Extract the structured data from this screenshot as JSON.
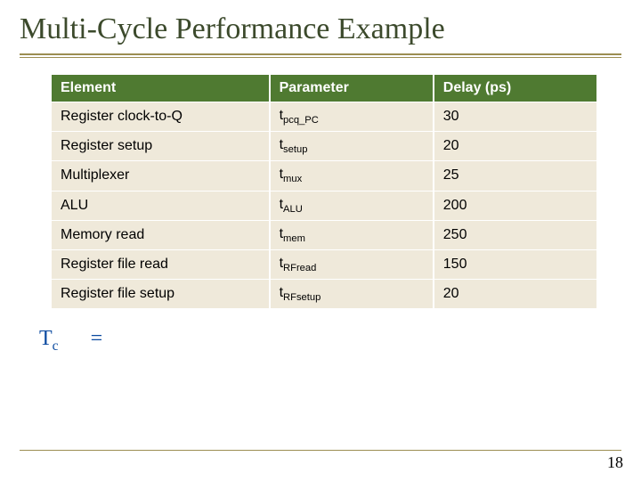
{
  "title": "Multi-Cycle Performance Example",
  "headers": {
    "element": "Element",
    "parameter": "Parameter",
    "delay": "Delay (ps)"
  },
  "rows": [
    {
      "element": "Register clock-to-Q",
      "param_base": "t",
      "param_sub": "pcq_PC",
      "delay": "30"
    },
    {
      "element": "Register setup",
      "param_base": "t",
      "param_sub": "setup",
      "delay": "20"
    },
    {
      "element": "Multiplexer",
      "param_base": "t",
      "param_sub": "mux",
      "delay": "25"
    },
    {
      "element": "ALU",
      "param_base": "t",
      "param_sub": "ALU",
      "delay": "200"
    },
    {
      "element": "Memory read",
      "param_base": "t",
      "param_sub": "mem",
      "delay": "250"
    },
    {
      "element": "Register file read",
      "param_base": "t",
      "param_sub": "RFread",
      "delay": "150"
    },
    {
      "element": "Register file setup",
      "param_base": "t",
      "param_sub": "RFsetup",
      "delay": "20"
    }
  ],
  "formula": {
    "lhs_base": "T",
    "lhs_sub": "c",
    "eq": "="
  },
  "page_number": "18",
  "chart_data": {
    "type": "table",
    "title": "Multi-Cycle Performance Example",
    "columns": [
      "Element",
      "Parameter",
      "Delay (ps)"
    ],
    "rows": [
      [
        "Register clock-to-Q",
        "t_pcq_PC",
        30
      ],
      [
        "Register setup",
        "t_setup",
        20
      ],
      [
        "Multiplexer",
        "t_mux",
        25
      ],
      [
        "ALU",
        "t_ALU",
        200
      ],
      [
        "Memory read",
        "t_mem",
        250
      ],
      [
        "Register file read",
        "t_RFread",
        150
      ],
      [
        "Register file setup",
        "t_RFsetup",
        20
      ]
    ]
  }
}
